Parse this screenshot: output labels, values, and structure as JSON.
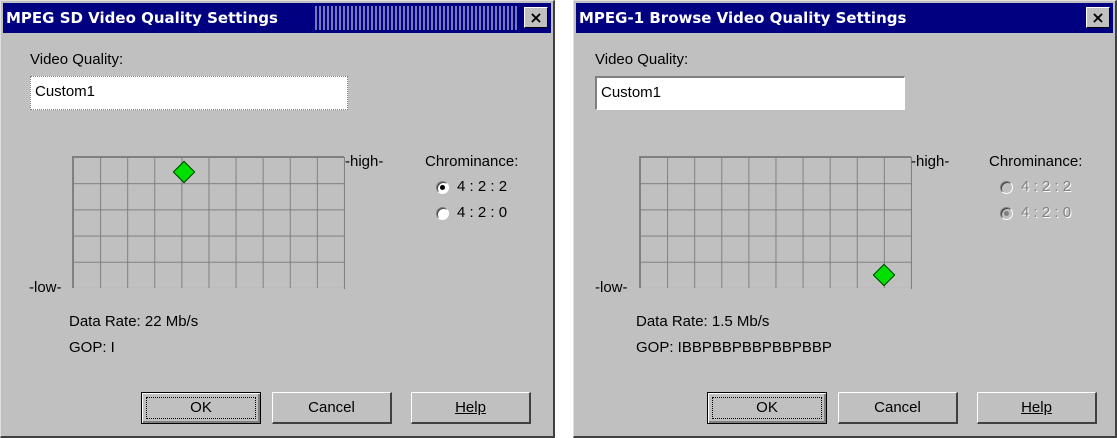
{
  "dialogs": [
    {
      "title": "MPEG SD Video Quality Settings",
      "close_label": "×",
      "video_quality_label": "Video Quality:",
      "video_quality_value": "Custom1",
      "high_label": "-high-",
      "low_label": "-low-",
      "chrominance_label": "Chrominance:",
      "chroma_options": [
        "4 : 2 : 2",
        "4 : 2 : 0"
      ],
      "chroma_selected": "4 : 2 : 2",
      "chroma_enabled": true,
      "data_rate_text": "Data Rate:  22 Mb/s",
      "gop_text": "GOP:  I",
      "ok_label": "OK",
      "cancel_label": "Cancel",
      "help_label": "Help"
    },
    {
      "title": "MPEG-1 Browse Video Quality Settings",
      "close_label": "×",
      "video_quality_label": "Video Quality:",
      "video_quality_value": "Custom1",
      "high_label": "-high-",
      "low_label": "-low-",
      "chrominance_label": "Chrominance:",
      "chroma_options": [
        "4 : 2 : 2",
        "4 : 2 : 0"
      ],
      "chroma_selected": "4 : 2 : 0",
      "chroma_enabled": false,
      "data_rate_text": "Data Rate:  1.5 Mb/s",
      "gop_text": "GOP:  IBBPBBPBBPBBPBBP",
      "ok_label": "OK",
      "cancel_label": "Cancel",
      "help_label": "Help"
    }
  ],
  "colors": {
    "titlebar": "#000080",
    "dialog_bg": "#c0c0c0",
    "marker": "#00e000"
  },
  "icons": {
    "quality_marker": "green-diamond-icon",
    "close": "close-icon"
  }
}
